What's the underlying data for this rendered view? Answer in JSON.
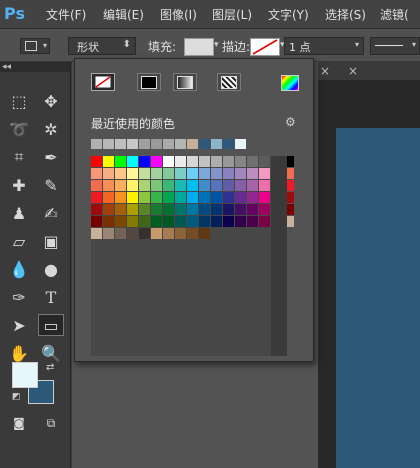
{
  "menubar": {
    "logo": "Ps",
    "items": [
      "文件(F)",
      "编辑(E)",
      "图像(I)",
      "图层(L)",
      "文字(Y)",
      "选择(S)",
      "滤镜("
    ]
  },
  "options": {
    "mode_label": "形状",
    "fill_label": "填充:",
    "stroke_label": "描边:",
    "stroke_width": "1 点"
  },
  "tabs": {
    "close_1": "×",
    "close_2": "×"
  },
  "toolbar": {
    "collapse": "◂◂",
    "type_tool": "T"
  },
  "panel": {
    "recent_label": "最近使用的颜色",
    "gear": "⚙",
    "recent_colors": [
      "#b0b0b0",
      "#b8b8b8",
      "#c0c0c0",
      "#c8c8c8",
      "#a0a0a0",
      "#9a9a9a",
      "#aaaaaa",
      "#b4b4b4",
      "#c4b09a",
      "#2d5978",
      "#8ab5cc",
      "#2d5978",
      "#e6f6fb"
    ],
    "swatches": [
      [
        "#ff0000",
        "#ffff00",
        "#00ff00",
        "#00ffff",
        "#0000ff",
        "#ff00ff",
        "#ffffff",
        "#ebebeb",
        "#d6d6d6",
        "#c2c2c2",
        "#adadad",
        "#999999",
        "#858585",
        "#707070",
        "#5c5c5c",
        "#474747",
        "#000000"
      ],
      [
        "#f7977a",
        "#f9ad81",
        "#fdc68a",
        "#fff79a",
        "#c4df9b",
        "#a2d39c",
        "#82ca9d",
        "#7bcdc8",
        "#6ecff6",
        "#7ea7d8",
        "#8493ca",
        "#8882be",
        "#a187be",
        "#bc8dbf",
        "#f49ac2",
        "#f6989d",
        "#f26c4f"
      ],
      [
        "#f26c4f",
        "#f68e55",
        "#fbaf5c",
        "#fff467",
        "#acd372",
        "#7cc576",
        "#3bb878",
        "#1abbb4",
        "#00bff3",
        "#438ccb",
        "#5574b9",
        "#605ca8",
        "#855fa8",
        "#a763a8",
        "#f06ea9",
        "#f26d7d",
        "#ed1c24"
      ],
      [
        "#ed1c24",
        "#f26522",
        "#f7941d",
        "#fff200",
        "#8dc63f",
        "#39b54a",
        "#00a651",
        "#00a99d",
        "#00aeef",
        "#0072bc",
        "#0054a6",
        "#2e3192",
        "#662d91",
        "#92278f",
        "#ec008c",
        "#ed145b",
        "#9e0b0f"
      ],
      [
        "#9e0b0f",
        "#a0410d",
        "#a36209",
        "#aba000",
        "#598527",
        "#1a7b30",
        "#007236",
        "#00746b",
        "#0076a3",
        "#004b80",
        "#003471",
        "#1b1464",
        "#440e62",
        "#630460",
        "#9e005d",
        "#9e0039",
        "#790000"
      ],
      [
        "#790000",
        "#7b2e00",
        "#7d4900",
        "#827b00",
        "#406618",
        "#005e20",
        "#005826",
        "#005952",
        "#005b7f",
        "#003663",
        "#002157",
        "#0d004c",
        "#32004b",
        "#4b0049",
        "#7b0046",
        "#7a0026",
        "#c7b299"
      ],
      [
        "#c7b299",
        "#998675",
        "#736357",
        "#534741",
        "#37302d",
        "#c69c6d",
        "#a67c52",
        "#8c6239",
        "#754c24",
        "#603913"
      ]
    ]
  }
}
